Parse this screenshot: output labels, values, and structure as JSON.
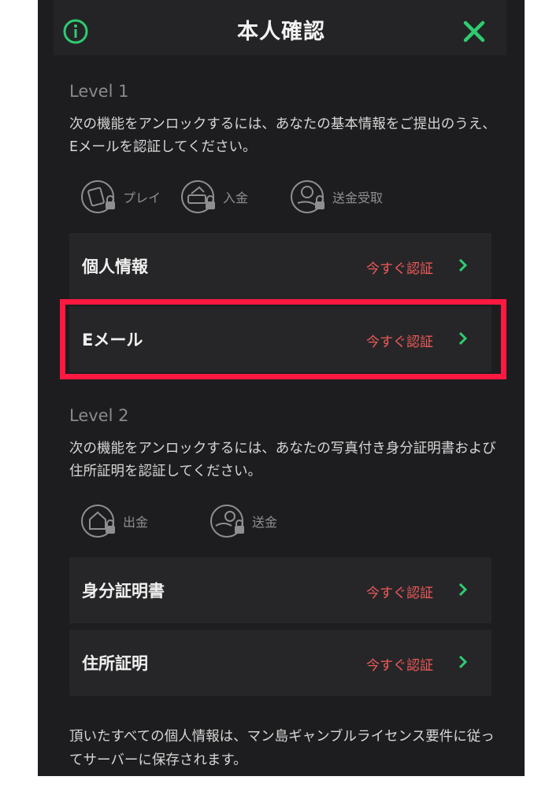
{
  "header": {
    "title": "本人確認"
  },
  "level1": {
    "label": "Level 1",
    "description": "次の機能をアンロックするには、あなたの基本情報をご提出のうえ、Eメールを認証してください。",
    "features": [
      {
        "icon": "play-lock-icon",
        "label": "プレイ"
      },
      {
        "icon": "deposit-lock-icon",
        "label": "入金"
      },
      {
        "icon": "transfer-receive-lock-icon",
        "label": "送金受取"
      }
    ],
    "rows": [
      {
        "label": "個人情報",
        "action": "今すぐ認証"
      },
      {
        "label": "Eメール",
        "action": "今すぐ認証"
      }
    ]
  },
  "level2": {
    "label": "Level 2",
    "description": "次の機能をアンロックするには、あなたの写真付き身分証明書および住所証明を認証してください。",
    "features": [
      {
        "icon": "withdraw-lock-icon",
        "label": "出金"
      },
      {
        "icon": "send-money-lock-icon",
        "label": "送金"
      }
    ],
    "rows": [
      {
        "label": "身分証明書",
        "action": "今すぐ認証"
      },
      {
        "label": "住所証明",
        "action": "今すぐ認証"
      }
    ]
  },
  "footer": {
    "text": "頂いたすべての個人情報は、マン島ギャンブルライセンス要件に従ってサーバーに保存されます。"
  },
  "colors": {
    "accent": "#2ecc71",
    "action": "#f05a5a",
    "highlight": "#ff1840",
    "background": "#1d1d1f"
  }
}
